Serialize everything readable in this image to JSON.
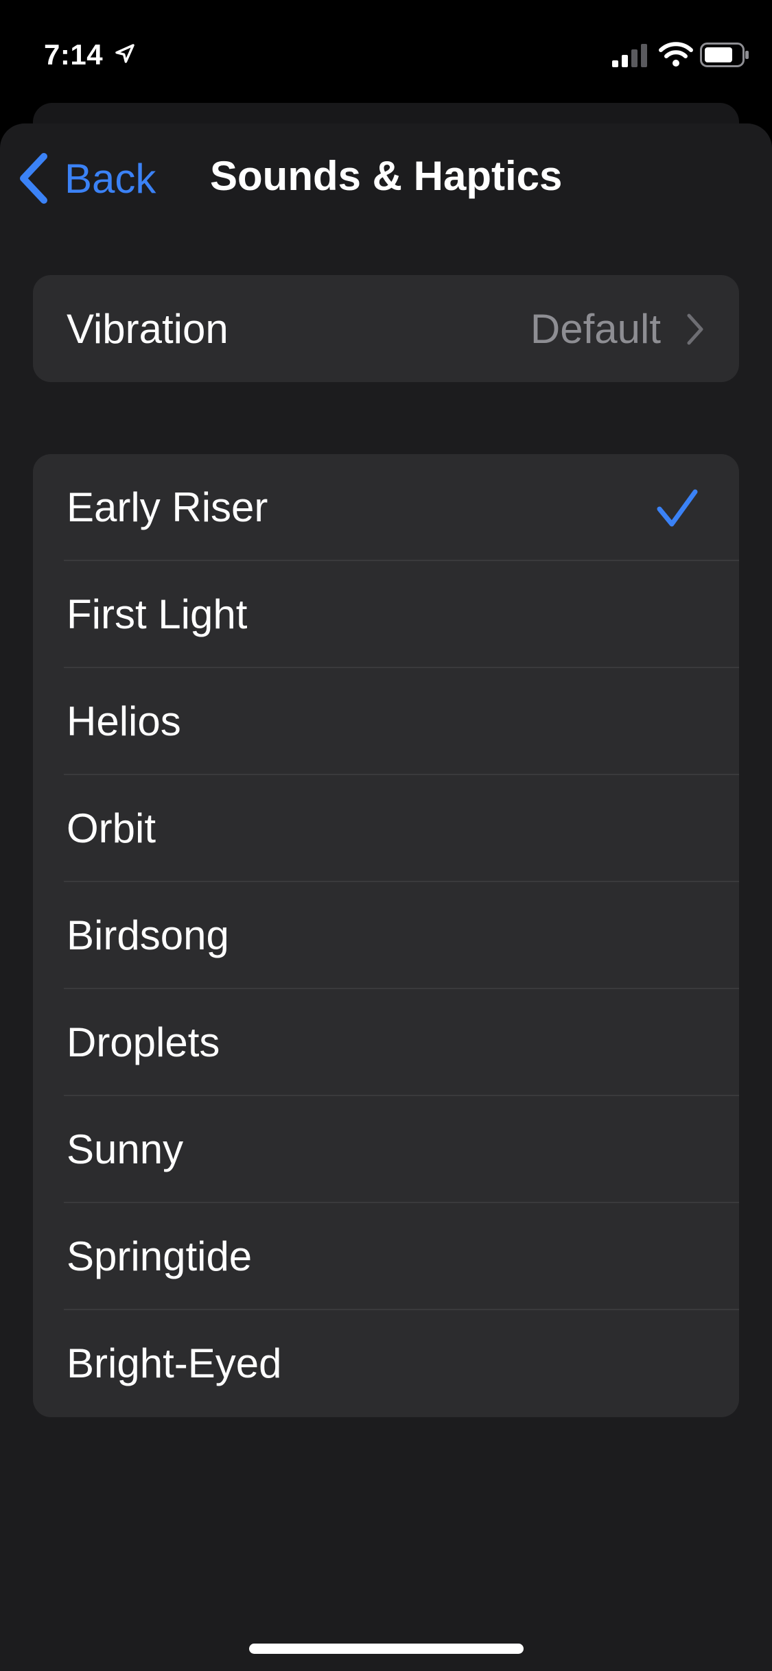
{
  "status_bar": {
    "time": "7:14",
    "icons": [
      "location-arrow-icon",
      "cellular-signal-icon",
      "wifi-icon",
      "battery-icon"
    ]
  },
  "nav": {
    "back_label": "Back",
    "title": "Sounds & Haptics",
    "icon": "chevron-left-icon"
  },
  "vibration": {
    "label": "Vibration",
    "value": "Default",
    "icon": "chevron-right-icon"
  },
  "tones": [
    {
      "label": "Early Riser",
      "selected": true
    },
    {
      "label": "First Light",
      "selected": false
    },
    {
      "label": "Helios",
      "selected": false
    },
    {
      "label": "Orbit",
      "selected": false
    },
    {
      "label": "Birdsong",
      "selected": false
    },
    {
      "label": "Droplets",
      "selected": false
    },
    {
      "label": "Sunny",
      "selected": false
    },
    {
      "label": "Springtide",
      "selected": false
    },
    {
      "label": "Bright-Eyed",
      "selected": false
    }
  ],
  "colors": {
    "accent": "#3b82f6",
    "background": "#1c1c1e",
    "card": "#2c2c2e",
    "secondary_text": "#8e8e93",
    "separator": "#3a3a3c"
  }
}
